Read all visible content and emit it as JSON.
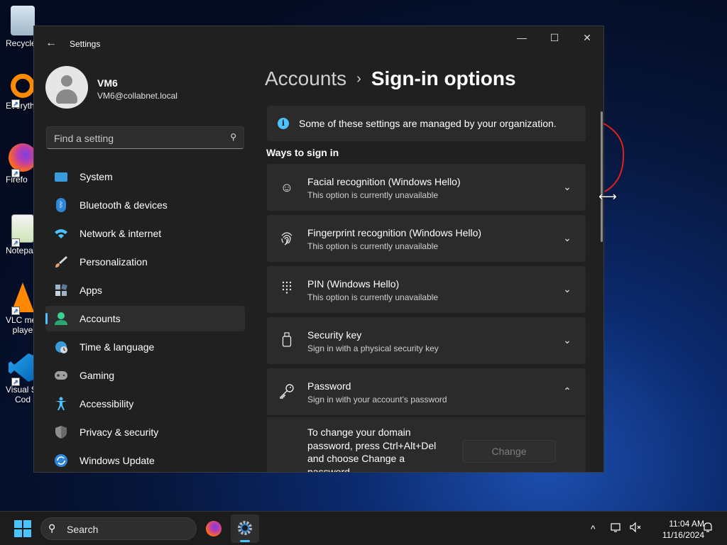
{
  "desktop": {
    "icons": [
      {
        "label": "Recycle",
        "icon": "recycle-bin-icon"
      },
      {
        "label": "Everyth",
        "icon": "everything-icon"
      },
      {
        "label": "Firefo",
        "icon": "firefox-icon"
      },
      {
        "label": "Notepa",
        "icon": "notepad-icon"
      },
      {
        "label": "VLC me",
        "label2": "playe",
        "icon": "vlc-icon"
      },
      {
        "label": "Visual St",
        "label2": "Cod",
        "icon": "vscode-icon"
      }
    ]
  },
  "window": {
    "app_title": "Settings",
    "controls": {
      "minimize": "—",
      "maximize": "☐",
      "close": "✕"
    }
  },
  "user": {
    "name": "VM6",
    "email": "VM6@collabnet.local"
  },
  "search": {
    "placeholder": "Find a setting"
  },
  "nav": {
    "items": [
      {
        "label": "System",
        "icon": "system-display-icon",
        "color": "#3a9bdc"
      },
      {
        "label": "Bluetooth & devices",
        "icon": "bluetooth-icon",
        "color": "#2f86d9"
      },
      {
        "label": "Network & internet",
        "icon": "wifi-icon",
        "color": "#4cc2ff"
      },
      {
        "label": "Personalization",
        "icon": "paintbrush-icon",
        "color": "#e4a16b"
      },
      {
        "label": "Apps",
        "icon": "apps-icon",
        "color": "#a0b4c8"
      },
      {
        "label": "Accounts",
        "icon": "account-icon",
        "color": "#3ccf91"
      },
      {
        "label": "Time & language",
        "icon": "globe-clock-icon",
        "color": "#3a9bdc"
      },
      {
        "label": "Gaming",
        "icon": "gamepad-icon",
        "color": "#a0a0a0"
      },
      {
        "label": "Accessibility",
        "icon": "accessibility-icon",
        "color": "#4cc2ff"
      },
      {
        "label": "Privacy & security",
        "icon": "shield-icon",
        "color": "#8e8e8e"
      },
      {
        "label": "Windows Update",
        "icon": "update-icon",
        "color": "#2f86d9"
      }
    ],
    "active_index": 5
  },
  "breadcrumb": {
    "parent": "Accounts",
    "separator": "›",
    "current": "Sign-in options"
  },
  "info_bar": {
    "text": "Some of these settings are managed by your organization."
  },
  "ways_to_sign_in": {
    "heading": "Ways to sign in",
    "options": [
      {
        "title": "Facial recognition (Windows Hello)",
        "subtitle": "This option is currently unavailable",
        "icon": "face-icon",
        "expanded": false
      },
      {
        "title": "Fingerprint recognition (Windows Hello)",
        "subtitle": "This option is currently unavailable",
        "icon": "fingerprint-icon",
        "expanded": false
      },
      {
        "title": "PIN (Windows Hello)",
        "subtitle": "This option is currently unavailable",
        "icon": "pin-keypad-icon",
        "expanded": false
      },
      {
        "title": "Security key",
        "subtitle": "Sign in with a physical security key",
        "icon": "usb-key-icon",
        "expanded": false
      },
      {
        "title": "Password",
        "subtitle": "Sign in with your account’s password",
        "icon": "key-icon",
        "expanded": true
      }
    ],
    "password_detail": {
      "description": "To change your domain password, press Ctrl+Alt+Del and choose Change a password",
      "button_label": "Change"
    }
  },
  "taskbar": {
    "search_label": "Search",
    "apps": [
      {
        "name": "Firefox",
        "icon": "firefox-icon"
      },
      {
        "name": "Settings",
        "icon": "settings-gear-icon",
        "active": true
      }
    ],
    "tray": {
      "chevron": "^",
      "time": "11:04 AM",
      "date": "11/16/2024"
    }
  }
}
